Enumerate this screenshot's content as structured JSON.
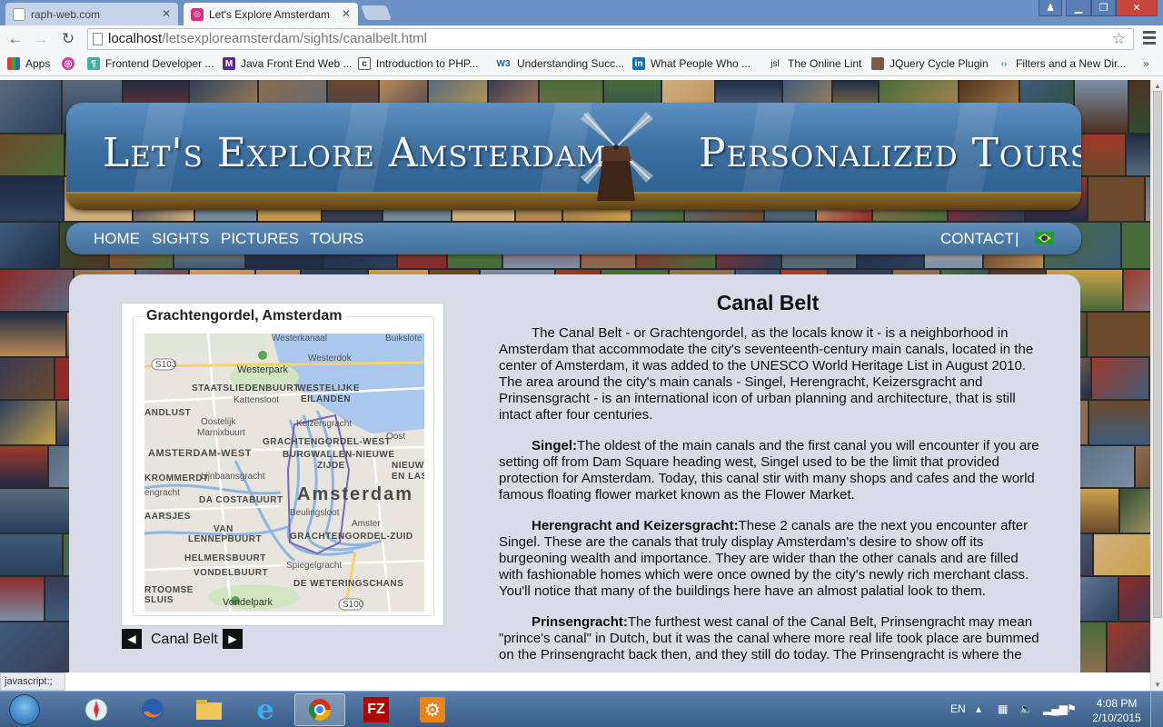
{
  "browser": {
    "tabs": [
      {
        "title": "raph-web.com",
        "active": false
      },
      {
        "title": "Let's Explore Amsterdam",
        "active": true
      }
    ],
    "url_host": "localhost",
    "url_path": "/letsexploreamsterdam/sights/canalbelt.html",
    "bookmarks": [
      {
        "label": "Apps",
        "icon": "apps-grid-icon"
      },
      {
        "label": "Frontend Developer ...",
        "icon": "treehouse-icon"
      },
      {
        "label": "Java Front End Web ...",
        "icon": "monster-icon"
      },
      {
        "label": "Introduction to PHP...",
        "icon": "document-icon"
      },
      {
        "label": "Understanding Succ...",
        "icon": "w3c-icon"
      },
      {
        "label": "What People Who ...",
        "icon": "linkedin-icon"
      },
      {
        "label": "The Online Lint",
        "icon": "jsl-icon"
      },
      {
        "label": "JQuery Cycle Plugin",
        "icon": "avatar-icon"
      },
      {
        "label": "Filters and a New Dir...",
        "icon": "code-brackets-icon"
      }
    ],
    "status_text": "javascript:;"
  },
  "site": {
    "title_left": "Let's Explore Amsterdam",
    "title_right": "Personalized Tours",
    "nav_left": [
      "HOME",
      "SIGHTS",
      "PICTURES",
      "TOURS"
    ],
    "nav_contact": "CONTACT",
    "nav_separator": "|",
    "language_flag": "brazil-flag-icon"
  },
  "map_card": {
    "legend": "Grachtengordel, Amsterdam",
    "caption": "Canal Belt",
    "labels": {
      "westerkanaal": "Westerkanaal",
      "buiksloten": "Buikslotе",
      "s103": "S103",
      "westerdok": "Westerdok",
      "westerpark": "Westerpark",
      "staatslieden": "STAATSLIEDENBUURT",
      "kattensloot": "Kattensloot",
      "westelijke": "WESTELIJKE",
      "eilanden": "EILANDEN",
      "landlust": "ANDLUST",
      "oostelijk": "Oostelijk",
      "marnixbuurt": "Marnixbuurt",
      "keizersgracht": "Keizersgracht",
      "grachtengordel_west": "GRACHTENGORDEL-WEST",
      "oost": "Oost",
      "amsterdam_west": "AMSTERDAM-WEST",
      "burgwallen": "BURGWALLEN-NIEUWE",
      "zijde": "ZIJDE",
      "nieuw": "NIEUW",
      "en_las": "EN LAS",
      "krommerdt": "KROMMERDT",
      "lijnbaansgracht": "Lijnbaansgracht",
      "engracht": "engracht",
      "city": "Amsterdam",
      "da_costa": "DA COSTABUURT",
      "beulingsloot": "Beulingsloot",
      "aarsjes": "AARSJES",
      "amster": "Amster",
      "van": "VAN",
      "lennepbuurt": "LENNEPBUURT",
      "gg_zuid": "GRACHTENGORDEL-ZUID",
      "helmersbuurt": "HELMERSBUURT",
      "spiegelgracht": "Spiegelgracht",
      "vondelbuurt": "VONDELBUURT",
      "rtoomse": "RTOOMSE",
      "weteringschans": "DE WETERINGSCHANS",
      "sluis": "SLUIS",
      "vondelpark": "Vondelpark",
      "s100": "S100"
    }
  },
  "article": {
    "heading": "Canal Belt",
    "intro": "The Canal Belt - or Grachtengordel, as the locals know it - is a neighborhood in Amsterdam that accommodate the city's seventeenth-century main canals, located in the center of Amsterdam, it was added to the UNESCO World Heritage List in August 2010. The area around the city's main canals - Singel, Herengracht, Keizersgracht and Prinsensgracht - is an international icon of urban planning and architecture, that is still intact after four centuries.",
    "sections": [
      {
        "term": "Singel:",
        "text": "The oldest of the main canals and the first canal you will encounter if you are setting off from Dam Square heading west, Singel used to be the limit that provided protection for Amsterdam. Today, this canal stir with many shops and cafes and the world famous floating flower market known as the Flower Market."
      },
      {
        "term": "Herengracht and Keizersgracht:",
        "text": "These 2 canals are the next you encounter after Singel. These are the canals that truly display Amsterdam's desire to show off its burgeoning wealth and importance. They are wider than the other canals and are filled with fashionable homes which were once owned by the city's newly rich merchant class. You'll notice that many of the buildings here have an almost palatial look to them."
      },
      {
        "term": "Prinsengracht:",
        "text": "The furthest west canal of the Canal Belt, Prinsengracht may mean \"prince's canal\" in Dutch, but it was the canal where more real life took place are bummed on the Prinsengracht back then, and they still do today. The Prinsengracht is where the"
      }
    ]
  },
  "taskbar": {
    "language": "EN",
    "time": "4:08 PM",
    "date": "2/10/2015",
    "pinned": [
      "start-orb-icon",
      "safari-icon",
      "firefox-icon",
      "explorer-folder-icon",
      "internet-explorer-icon",
      "chrome-icon",
      "filezilla-icon",
      "gear-app-icon"
    ]
  },
  "colors": {
    "tab_strip": "#6d91c4",
    "banner_blue": "#3a6e9f",
    "content_bg": "#d7dce8",
    "taskbar": "#3a5e88"
  }
}
